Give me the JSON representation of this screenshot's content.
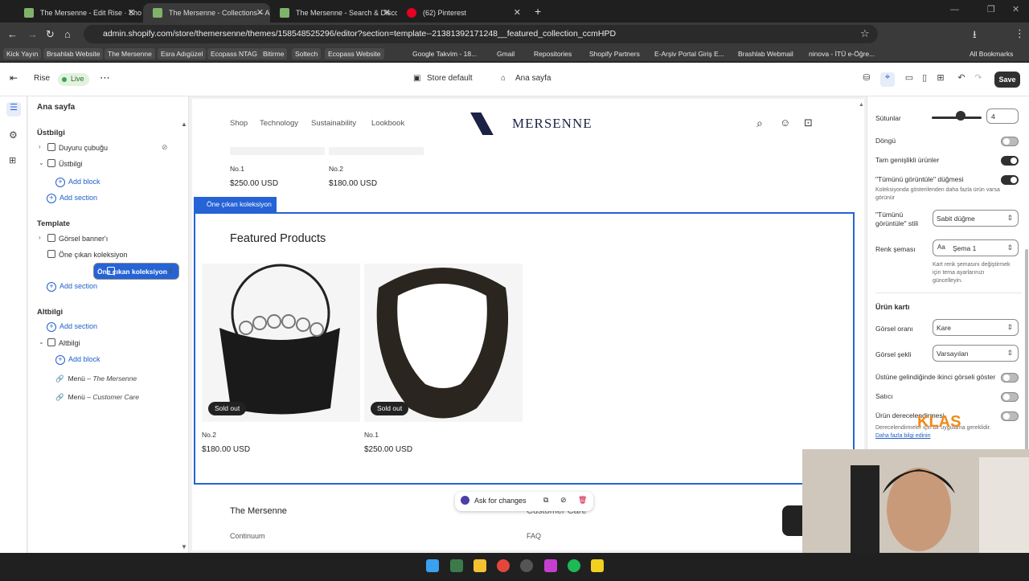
{
  "browser": {
    "tabs": [
      {
        "label": "The Mersenne - Edit Rise · Shop"
      },
      {
        "label": "The Mersenne - Collections – Ad"
      },
      {
        "label": "The Mersenne - Search & Disco"
      },
      {
        "label": "(62) Pinterest"
      }
    ],
    "url": "admin.shopify.com/store/themersenne/themes/158548525296/editor?section=template--21381392171248__featured_collection_ccmHPD",
    "bookmarks": [
      "Kick Yayın",
      "Brsahlab Website",
      "The Mersenne",
      "Esra Adıgüzel",
      "Ecopass NTAG",
      "Bitirme",
      "Soltech",
      "Ecopass Website",
      "Google Takvim - 18...",
      "Gmail",
      "Repositories",
      "Shopify Partners",
      "E-Arşiv Portal Giriş E...",
      "Brashlab Webmail",
      "ninova - İTÜ e-Öğre...",
      "All Bookmarks"
    ]
  },
  "editor": {
    "theme": "Rise",
    "live": "Live",
    "template_select": "Store default",
    "page_select": "Ana sayfa",
    "save": "Save",
    "panel": {
      "title": "Ana sayfa",
      "header_group": "Üstbilgi",
      "header_items": [
        "Duyuru çubuğu",
        "Üstbilgi"
      ],
      "add_block": "Add block",
      "add_section": "Add section",
      "template_group": "Template",
      "template_items": [
        "Görsel banner'ı",
        "Öne çıkan koleksiyon",
        "Öne çıkan koleksiyon"
      ],
      "footer_group": "Altbilgi",
      "footer_item": "Altbilgi",
      "menus": [
        {
          "label": "Menü",
          "sub": "The Mersenne"
        },
        {
          "label": "Menü",
          "sub": "Customer Care"
        }
      ]
    },
    "settings": {
      "columns_label": "Sütunlar",
      "columns_value": "4",
      "loop": "Döngü",
      "full_width": "Tam genişlikli ürünler",
      "view_all": "\"Tümünü görüntüle\" düğmesi",
      "view_all_hint": "Koleksiyonda gösterilenden daha fazla ürün varsa görünür",
      "view_all_style_label": "\"Tümünü görüntüle\" stili",
      "view_all_style": "Sabit düğme",
      "color_label": "Renk şeması",
      "color_value": "Şema 1",
      "color_hint": "Kart renk şemasını değiştirmek için tema ayarlarınızı güncelleyin.",
      "product_card": "Ürün kartı",
      "ratio_label": "Görsel oranı",
      "ratio_value": "Kare",
      "shape_label": "Görsel şekli",
      "shape_value": "Varsayılan",
      "hover": "Üstüne gelindiğinde ikinci görseli göster",
      "vendor": "Satıcı",
      "rating": "Ürün derecelendirmesi",
      "rating_hint": "Derecelendirmeler için bir uygulama gereklidir.",
      "learn_more": "Daha fazla bilgi edinin"
    }
  },
  "store": {
    "nav": [
      "Shop",
      "Technology",
      "Sustainability",
      "Lookbook"
    ],
    "logo": "MERSENNE",
    "prev_products": [
      {
        "name": "No.1",
        "price": "$250.00 USD"
      },
      {
        "name": "No.2",
        "price": "$180.00 USD"
      }
    ],
    "section_tag": "Öne çıkan koleksiyon",
    "featured_title": "Featured Products",
    "products": [
      {
        "name": "No.2",
        "price": "$180.00 USD",
        "badge": "Sold out"
      },
      {
        "name": "No.1",
        "price": "$250.00 USD",
        "badge": "Sold out"
      }
    ],
    "ask": "Ask for changes",
    "footer_title": "The Mersenne",
    "footer_title2": "Customer Care",
    "footer_links": [
      "Continuum",
      "FAQ"
    ]
  },
  "overlay": {
    "watermark": "KLAS"
  }
}
